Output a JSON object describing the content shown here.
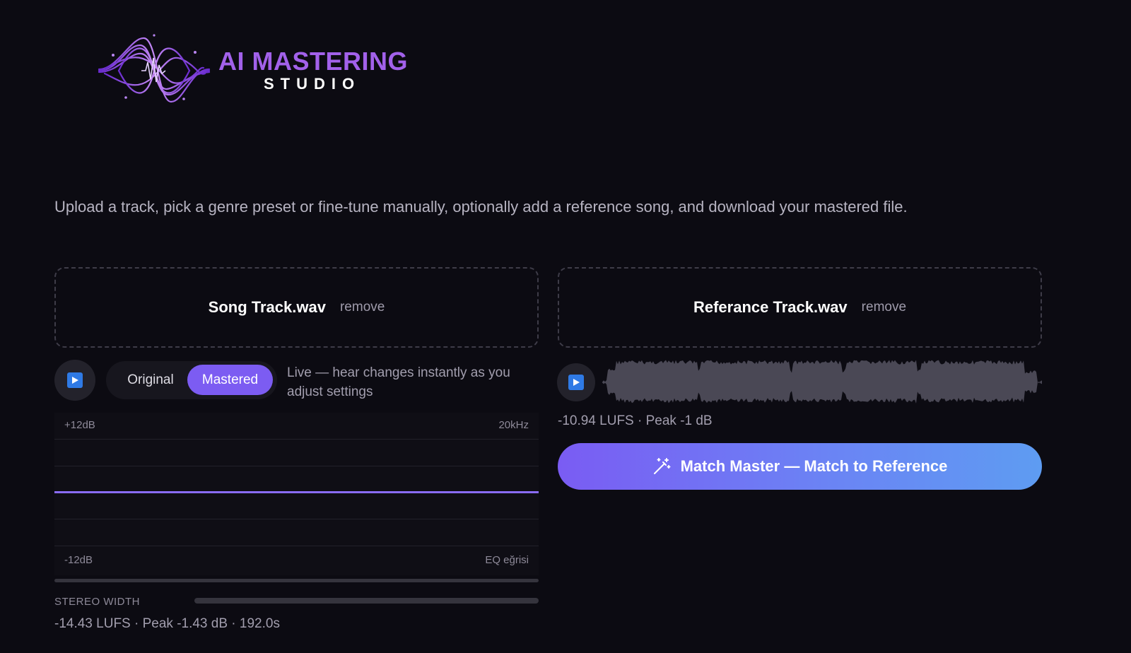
{
  "brand": {
    "title": "AI MASTERING",
    "subtitle": "STUDIO",
    "accent_color": "#a261ea"
  },
  "intro_text": "Upload a track, pick a genre preset or fine-tune manually, optionally add a reference song, and download your mastered file.",
  "song": {
    "filename": "Song Track.wav",
    "remove_label": "remove",
    "play_icon": "play-icon",
    "toggle": {
      "options": [
        "Original",
        "Mastered"
      ],
      "selected": "Mastered"
    },
    "live_note": "Live — hear changes instantly as you adjust settings",
    "eq": {
      "top_left_label": "+12dB",
      "top_right_label": "20kHz",
      "bottom_left_label": "-12dB",
      "bottom_right_label": "EQ eğrisi",
      "curve_color": "#8a6cf7"
    },
    "stereo_width_label": "STEREO WIDTH",
    "stats": "-14.43 LUFS · Peak -1.43 dB · 192.0s"
  },
  "reference": {
    "filename": "Referance Track.wav",
    "remove_label": "remove",
    "play_icon": "play-icon",
    "stats": "-10.94 LUFS · Peak -1 dB"
  },
  "match_button": {
    "icon": "magic-wand-icon",
    "label": "Match Master — Match to Reference",
    "gradient": [
      "#7a5cf3",
      "#5e9cf2"
    ]
  }
}
